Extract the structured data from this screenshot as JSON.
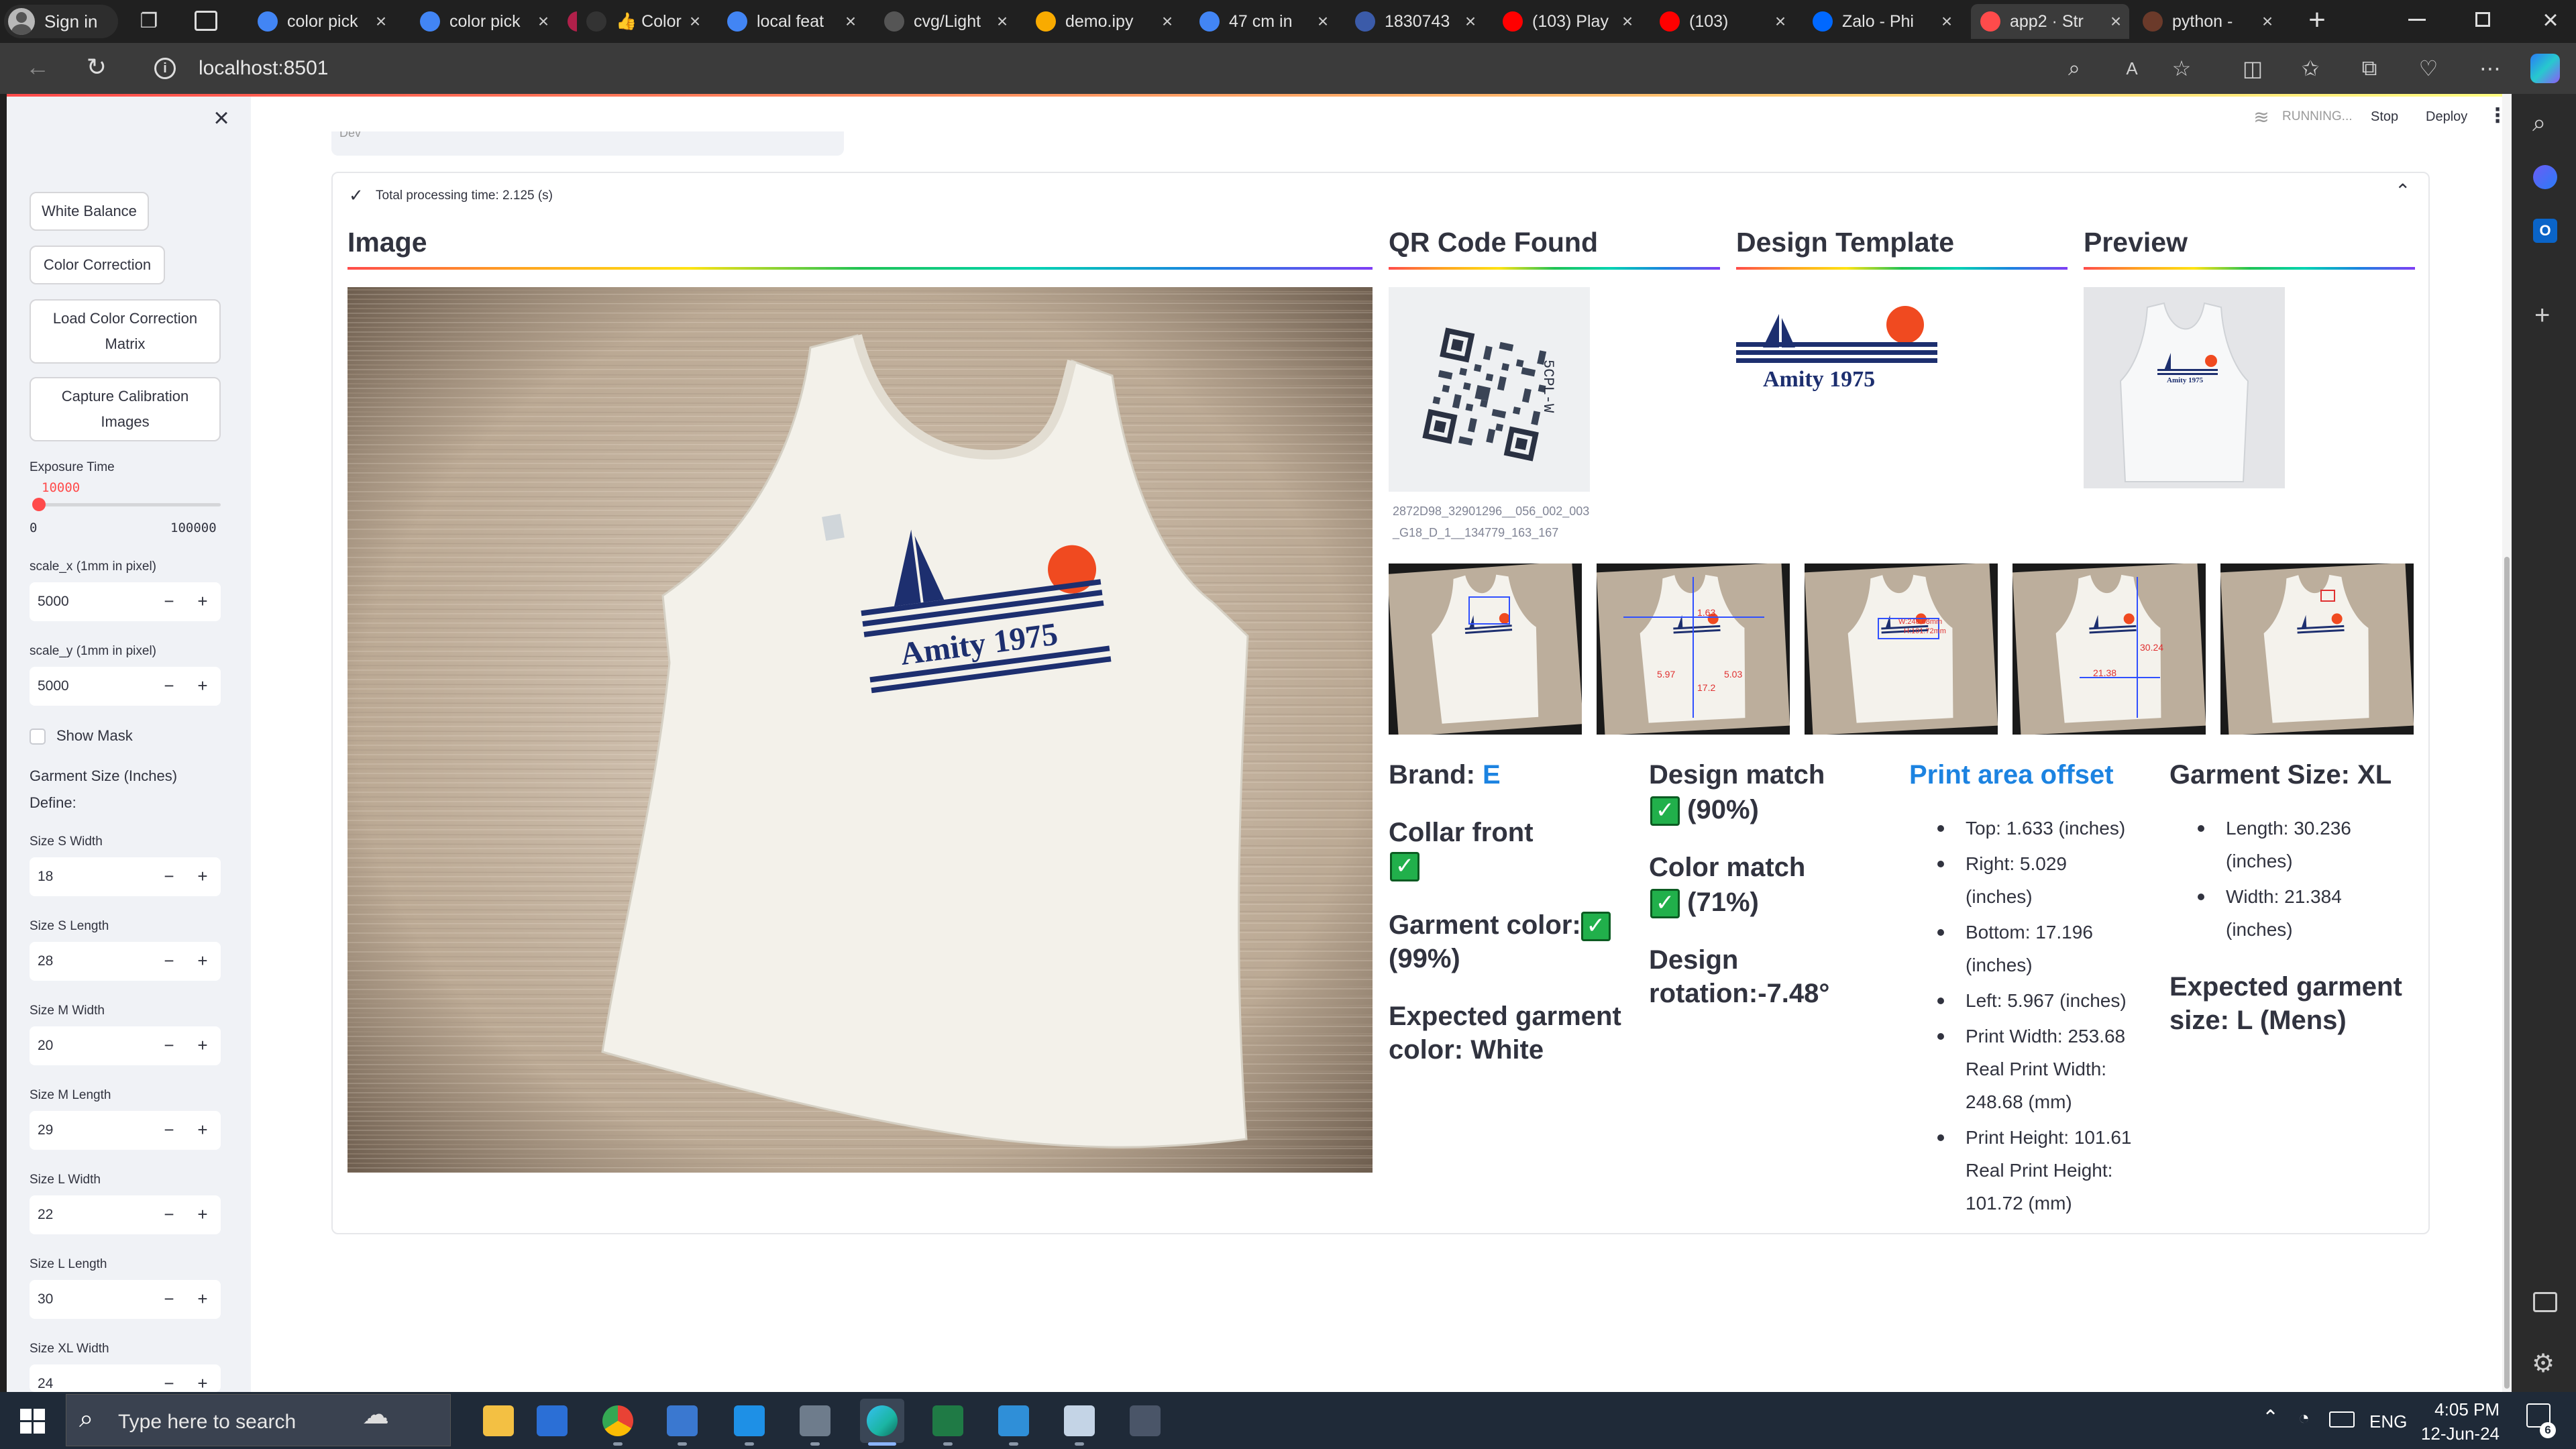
{
  "browser": {
    "profile_label": "Sign in",
    "tabs": [
      {
        "title": "color pick",
        "icon": "google-icon",
        "color": "#4285f4"
      },
      {
        "title": "color pick",
        "icon": "google-icon",
        "color": "#4285f4"
      },
      {
        "title": "",
        "icon": "app-icon",
        "color": "#b0204a"
      },
      {
        "title": "👍 Color",
        "icon": "thumb-icon",
        "color": "#333"
      },
      {
        "title": "local feat",
        "icon": "google-icon",
        "color": "#4285f4"
      },
      {
        "title": "cvg/Light",
        "icon": "github-icon",
        "color": "#555"
      },
      {
        "title": "demo.ipy",
        "icon": "colab-icon",
        "color": "#f9ab00"
      },
      {
        "title": "47 cm in",
        "icon": "google-icon",
        "color": "#4285f4"
      },
      {
        "title": "1830743",
        "icon": "image-icon",
        "color": "#3b5ba9"
      },
      {
        "title": "(103) Play",
        "icon": "youtube-icon",
        "color": "#ff0000"
      },
      {
        "title": "(103)",
        "icon": "youtube-icon",
        "color": "#ff0000"
      },
      {
        "title": "Zalo - Phi",
        "icon": "zalo-icon",
        "color": "#0068ff"
      },
      {
        "title": "app2 · Str",
        "icon": "streamlit-icon",
        "color": "#ff4b4b"
      },
      {
        "title": "python -",
        "icon": "python-icon",
        "color": "#6b3a2a"
      }
    ],
    "url": "localhost:8501"
  },
  "app_header": {
    "running_label": "RUNNING...",
    "stop_label": "Stop",
    "deploy_label": "Deploy"
  },
  "sidebar": {
    "close_glyph": "×",
    "buttons": {
      "white_balance": "White Balance",
      "color_correction": "Color Correction",
      "load_ccm": "Load Color Correction Matrix",
      "capture": "Capture Calibration Images"
    },
    "exposure": {
      "label": "Exposure Time",
      "value": "10000",
      "min": "0",
      "max": "100000",
      "fraction": 0.1
    },
    "scale_x": {
      "label": "scale_x (1mm in pixel)",
      "value": "5000"
    },
    "scale_y": {
      "label": "scale_y (1mm in pixel)",
      "value": "5000"
    },
    "show_mask": "Show Mask",
    "garment_size_label": "Garment Size (Inches)",
    "define_label": "Define:",
    "sizes": [
      {
        "label": "Size S Width",
        "value": "18"
      },
      {
        "label": "Size S Length",
        "value": "28"
      },
      {
        "label": "Size M Width",
        "value": "20"
      },
      {
        "label": "Size M Length",
        "value": "29"
      },
      {
        "label": "Size L Width",
        "value": "22"
      },
      {
        "label": "Size L Length",
        "value": "30"
      },
      {
        "label": "Size XL Width",
        "value": "24"
      }
    ],
    "minus": "−",
    "plus": "+"
  },
  "main": {
    "partial_top_text": "Dev",
    "status_text": "Total processing time: 2.125 (s)",
    "headers": {
      "image": "Image",
      "qr": "QR Code Found",
      "design": "Design Template",
      "preview": "Preview"
    },
    "qr_caption": "2872D98_32901296__056_002_003_G18_D_1__134779_163_167",
    "design_text": "Amity 1975",
    "thumb_labels": {
      "t2": [
        "1.63",
        "5.97",
        "5.03",
        "17.2"
      ],
      "t3": [
        "W:248.68mm",
        "H:101.72mm"
      ],
      "t4": [
        "30.24",
        "21.38"
      ]
    },
    "brand_label": "Brand:",
    "brand_value": "E",
    "collar_front": "Collar front",
    "garment_color_label": "Garment color:",
    "garment_color_pct": "(99%)",
    "expected_color": "Expected garment color: White",
    "design_match_label": "Design match",
    "design_match_pct": "(90%)",
    "color_match_label": "Color match",
    "color_match_pct": "(71%)",
    "design_rotation": "Design rotation:-7.48°",
    "print_area_title": "Print area offset",
    "print_area_items": [
      [
        "Top: 1.633 (inches)"
      ],
      [
        "Right: 5.029",
        "(inches)"
      ],
      [
        "Bottom: 17.196",
        "(inches)"
      ],
      [
        "Left: 5.967 (inches)"
      ],
      [
        "Print Width: 253.68",
        "Real Print Width:",
        "248.68 (mm)"
      ],
      [
        "Print Height: 101.61",
        "Real Print Height:",
        "101.72 (mm)"
      ]
    ],
    "garment_size_title": "Garment Size: XL",
    "garment_size_items": [
      [
        "Length: 30.236",
        "(inches)"
      ],
      [
        "Width: 21.384",
        "(inches)"
      ]
    ],
    "expected_size": "Expected garment size: L (Mens)",
    "check_glyph": "✓"
  },
  "taskbar": {
    "search_placeholder": "Type here to search",
    "lang": "ENG",
    "time": "4:05 PM",
    "date": "12-Jun-24",
    "notif_count": "6"
  },
  "colors": {
    "accent": "#ff4b4b",
    "check_green": "#21b04b",
    "link_blue": "#1c83e1"
  }
}
